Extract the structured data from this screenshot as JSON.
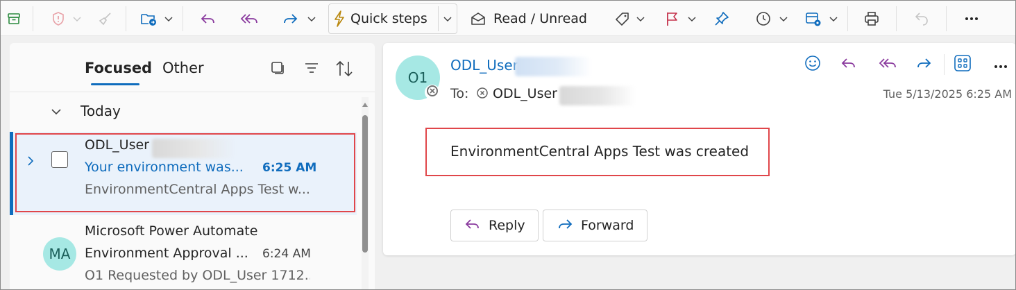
{
  "toolbar": {
    "quick_steps_label": "Quick steps",
    "read_unread_label": "Read / Unread",
    "icons": [
      "archive-icon",
      "report-icon",
      "sweep-icon",
      "move-icon",
      "reply-icon",
      "reply-all-icon",
      "forward-icon",
      "lightning-icon",
      "envelope-open-icon",
      "tag-icon",
      "flag-icon",
      "pin-icon",
      "clock-icon",
      "rules-icon",
      "print-icon",
      "undo-icon",
      "more-icon"
    ]
  },
  "mail_list": {
    "tabs": [
      {
        "label": "Focused",
        "active": true
      },
      {
        "label": "Other",
        "active": false
      }
    ],
    "group_label": "Today",
    "items": [
      {
        "sender": "ODL_User",
        "subject": "Your environment was...",
        "time": "6:25 AM",
        "preview": "EnvironmentCentral Apps Test w...",
        "selected": true,
        "unread": true
      },
      {
        "avatar": "MA",
        "sender": "Microsoft Power Automate",
        "subject": "Environment Approval ...",
        "time": "6:24 AM",
        "preview": "O1 Requested by ODL_User 1712...",
        "selected": false,
        "unread": false
      }
    ]
  },
  "reading_pane": {
    "avatar": "O1",
    "from": "ODL_User",
    "to_label": "To:",
    "to_name": "ODL_User",
    "date": "Tue 5/13/2025 6:25 AM",
    "body": "EnvironmentCentral Apps Test was created",
    "reply_label": "Reply",
    "forward_label": "Forward"
  },
  "colors": {
    "accent": "#0f6cbd",
    "highlight_box": "#e0464a",
    "avatar_bg": "#a6e8e4",
    "flag": "#c4314b",
    "reply_purple": "#8a3a9e"
  }
}
